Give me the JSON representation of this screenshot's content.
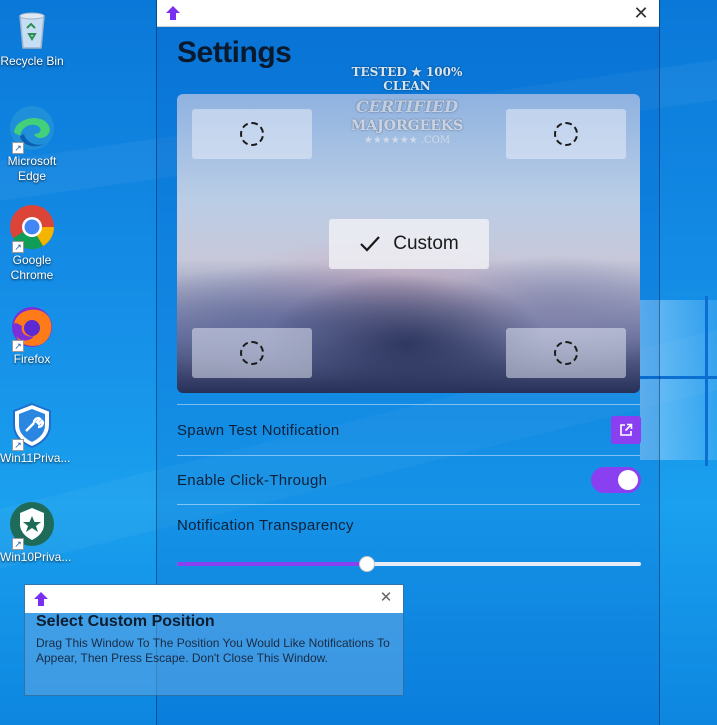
{
  "desktop": {
    "icons": [
      {
        "label": "Recycle Bin",
        "icon": "recycle-bin-icon"
      },
      {
        "label": "Microsoft Edge",
        "icon": "edge-icon"
      },
      {
        "label": "Google Chrome",
        "icon": "chrome-icon"
      },
      {
        "label": "Firefox",
        "icon": "firefox-icon"
      },
      {
        "label": "Win11Priva...",
        "icon": "win11privacy-icon"
      },
      {
        "label": "Win10Priva...",
        "icon": "win10privacy-icon"
      }
    ]
  },
  "settings": {
    "title": "Settings",
    "positions": {
      "top_left": "spinner-icon",
      "top_right": "spinner-icon",
      "bottom_left": "spinner-icon",
      "bottom_right": "spinner-icon",
      "custom_label": "Custom"
    },
    "spawn_test_label": "Spawn Test Notification",
    "click_through_label": "Enable Click-Through",
    "click_through_enabled": true,
    "transparency_label": "Notification Transparency",
    "transparency_value": 0.41,
    "accent_color": "#8a3ff0"
  },
  "watermark": {
    "line1": "TESTED ★ 100% CLEAN",
    "line2": "CERTIFIED",
    "line3": "MAJORGEEKS",
    "line4": "★★★★★★ .COM"
  },
  "popup": {
    "title": "Select Custom Position",
    "text": "Drag This Window To The Position You Would Like Notifications To Appear, Then Press Escape. Don't Close This Window."
  }
}
